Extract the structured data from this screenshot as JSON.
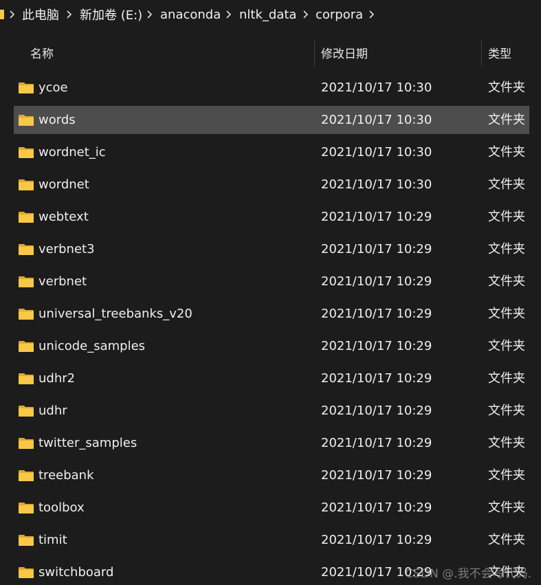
{
  "breadcrumb": {
    "items": [
      {
        "label": "此电脑"
      },
      {
        "label": "新加卷 (E:)"
      },
      {
        "label": "anaconda"
      },
      {
        "label": "nltk_data"
      },
      {
        "label": "corpora"
      }
    ]
  },
  "columns": {
    "name": "名称",
    "date_modified": "修改日期",
    "type": "类型"
  },
  "files": [
    {
      "name": "ycoe",
      "date": "2021/10/17 10:30",
      "type": "文件夹",
      "selected": false
    },
    {
      "name": "words",
      "date": "2021/10/17 10:30",
      "type": "文件夹",
      "selected": true
    },
    {
      "name": "wordnet_ic",
      "date": "2021/10/17 10:30",
      "type": "文件夹",
      "selected": false
    },
    {
      "name": "wordnet",
      "date": "2021/10/17 10:30",
      "type": "文件夹",
      "selected": false
    },
    {
      "name": "webtext",
      "date": "2021/10/17 10:29",
      "type": "文件夹",
      "selected": false
    },
    {
      "name": "verbnet3",
      "date": "2021/10/17 10:29",
      "type": "文件夹",
      "selected": false
    },
    {
      "name": "verbnet",
      "date": "2021/10/17 10:29",
      "type": "文件夹",
      "selected": false
    },
    {
      "name": "universal_treebanks_v20",
      "date": "2021/10/17 10:29",
      "type": "文件夹",
      "selected": false
    },
    {
      "name": "unicode_samples",
      "date": "2021/10/17 10:29",
      "type": "文件夹",
      "selected": false
    },
    {
      "name": "udhr2",
      "date": "2021/10/17 10:29",
      "type": "文件夹",
      "selected": false
    },
    {
      "name": "udhr",
      "date": "2021/10/17 10:29",
      "type": "文件夹",
      "selected": false
    },
    {
      "name": "twitter_samples",
      "date": "2021/10/17 10:29",
      "type": "文件夹",
      "selected": false
    },
    {
      "name": "treebank",
      "date": "2021/10/17 10:29",
      "type": "文件夹",
      "selected": false
    },
    {
      "name": "toolbox",
      "date": "2021/10/17 10:29",
      "type": "文件夹",
      "selected": false
    },
    {
      "name": "timit",
      "date": "2021/10/17 10:29",
      "type": "文件夹",
      "selected": false
    },
    {
      "name": "switchboard",
      "date": "2021/10/17 10:29",
      "type": "文件夹",
      "selected": false
    }
  ],
  "icons": {
    "folder": "folder-icon",
    "separator": "chevron-right-icon"
  },
  "colors": {
    "background": "#1c1c1c",
    "selected_row": "#4d4d4d",
    "folder_yellow": "#f9c846"
  },
  "watermark": "CSDN @.我不会写代码."
}
